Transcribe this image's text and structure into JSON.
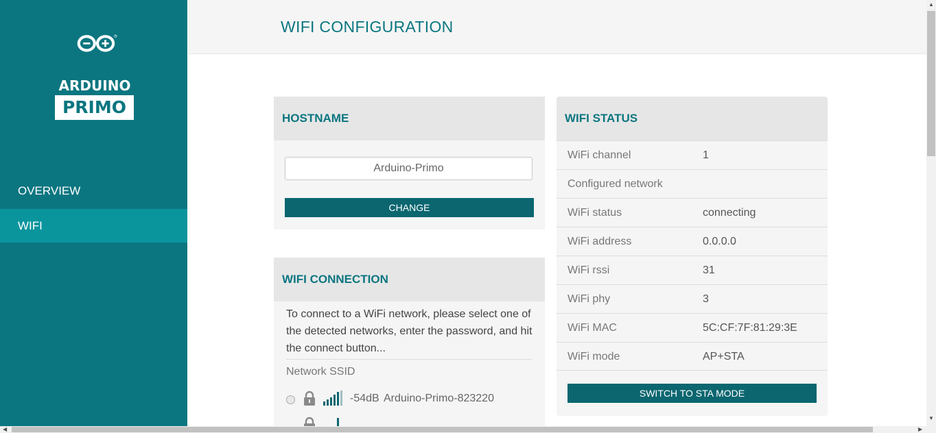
{
  "brand": {
    "line1": "ARDUINO",
    "line2": "PRIMO",
    "registered": "®"
  },
  "nav": [
    {
      "label": "OVERVIEW",
      "active": false
    },
    {
      "label": "WIFI",
      "active": true
    }
  ],
  "header": {
    "title": "WIFI CONFIGURATION"
  },
  "hostname": {
    "title": "HOSTNAME",
    "value": "Arduino-Primo",
    "button": "CHANGE"
  },
  "connection": {
    "title": "WIFI CONNECTION",
    "description": "To connect to a WiFi network, please select one of the detected networks, enter the password, and hit the connect button...",
    "ssid_label": "Network SSID",
    "networks": [
      {
        "rssi": "-54dB",
        "ssid": "Arduino-Primo-823220",
        "locked": true,
        "signal": 5
      }
    ]
  },
  "status": {
    "title": "WIFI STATUS",
    "rows": [
      {
        "key": "WiFi channel",
        "value": "1"
      },
      {
        "key": "Configured network",
        "value": ""
      },
      {
        "key": "WiFi status",
        "value": "connecting"
      },
      {
        "key": "WiFi address",
        "value": "0.0.0.0"
      },
      {
        "key": "WiFi rssi",
        "value": "31"
      },
      {
        "key": "WiFi phy",
        "value": "3"
      },
      {
        "key": "WiFi MAC",
        "value": "5C:CF:7F:81:29:3E"
      },
      {
        "key": "WiFi mode",
        "value": "AP+STA"
      }
    ],
    "button": "SWITCH TO STA MODE"
  },
  "colors": {
    "brand": "#0b7680",
    "active_nav": "#0a959d",
    "button": "#0b6670",
    "card": "#f5f5f5",
    "card_head": "#e6e6e6"
  },
  "icons": {
    "logo": "arduino-infinity-logo",
    "lock": "lock-icon",
    "signal": "wifi-signal-bars-icon"
  }
}
